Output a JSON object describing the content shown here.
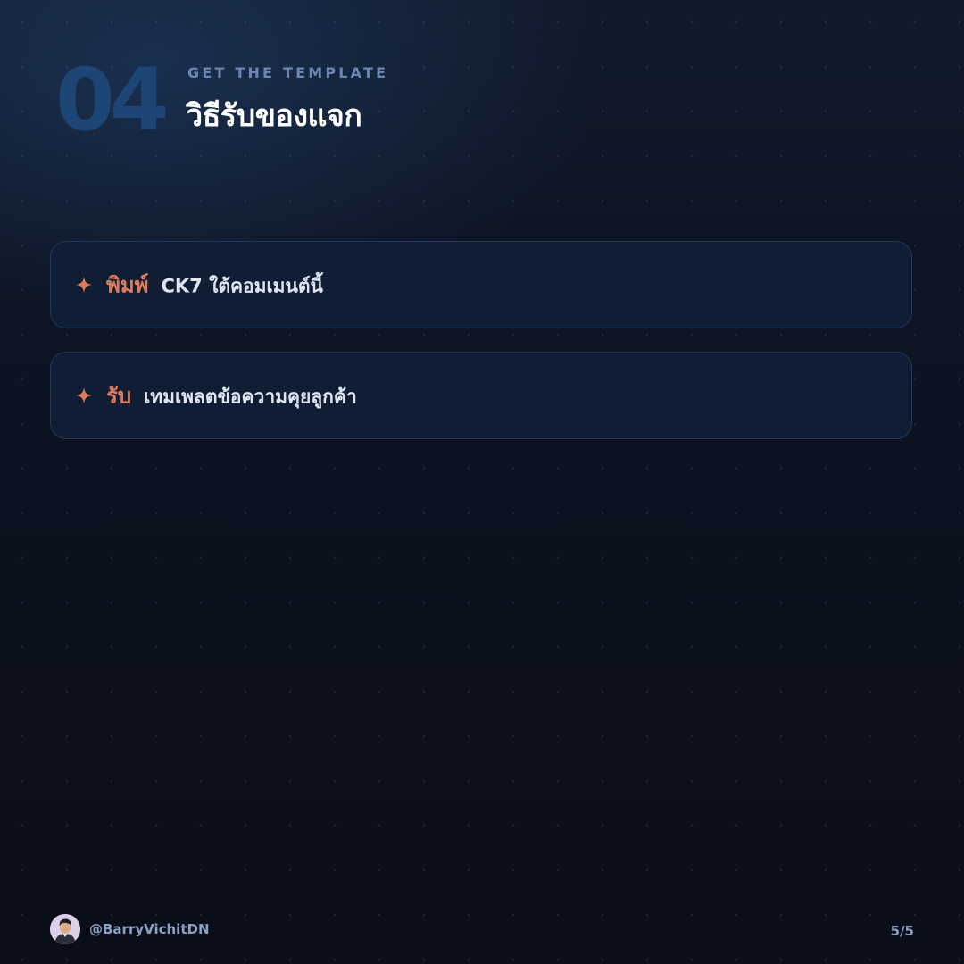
{
  "header": {
    "section_number": "04",
    "eyebrow": "GET THE TEMPLATE",
    "title": "วิธีรับของแจก"
  },
  "steps": [
    {
      "icon": "sparkle-icon",
      "keyword": "พิมพ์",
      "description": "CK7 ใต้คอมเมนต์นี้"
    },
    {
      "icon": "sparkle-icon",
      "keyword": "รับ",
      "description": "เทมเพลตข้อความคุยลูกค้า"
    }
  ],
  "footer": {
    "handle": "@BarryVichitDN",
    "page_counter": "5/5"
  },
  "colors": {
    "accent": "#e07a5a",
    "section_number": "#1d4575",
    "eyebrow": "#6d87b3",
    "card_background": "#0f1e34",
    "card_border": "#1f3a5c",
    "page_background": "#0b0f1a"
  }
}
